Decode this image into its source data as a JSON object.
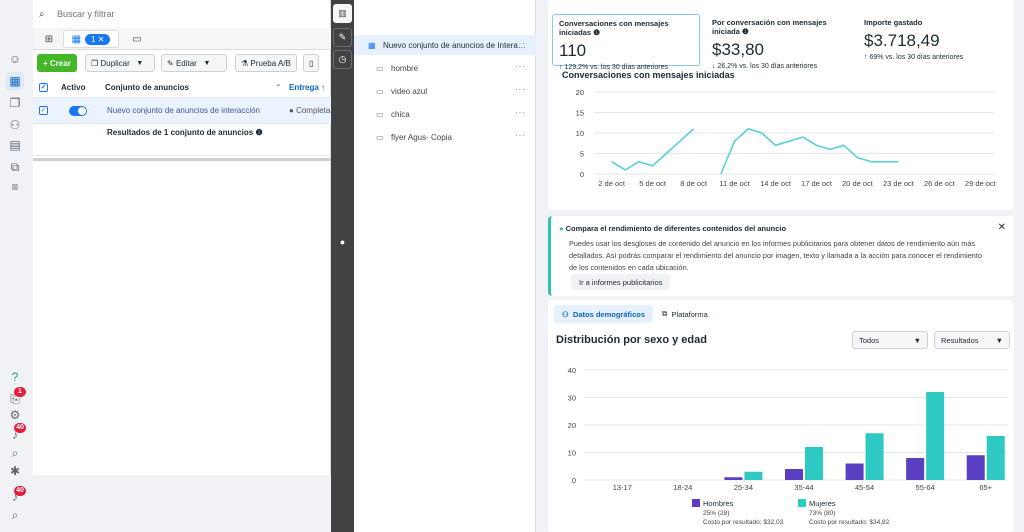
{
  "search": {
    "placeholder": "Buscar y filtrar"
  },
  "tabs": {
    "badge_count": "1"
  },
  "toolbar": {
    "create": "Crear",
    "duplicate": "Duplicar",
    "edit": "Editar",
    "ab_test": "Prueba A/B"
  },
  "table": {
    "col_active": "Activo",
    "col_adset": "Conjunto de anuncios",
    "col_delivery": "Entrega",
    "row": {
      "name": "Nuevo conjunto de anuncios de interacción",
      "delivery": "Completa"
    },
    "results": "Resultados de 1 conjunto de anuncios"
  },
  "rail": {
    "badges": [
      "1",
      "40",
      "40"
    ]
  },
  "mid_list": {
    "items": [
      {
        "label": "Nuevo conjunto de anuncios de Intera…",
        "selected": true
      },
      {
        "label": "hombre"
      },
      {
        "label": "video azul"
      },
      {
        "label": "chica"
      },
      {
        "label": "flyer Agus- Copia"
      }
    ],
    "more": "···"
  },
  "kpis": [
    {
      "label": "Conversaciones con mensajes iniciadas",
      "value": "110",
      "delta": "129,2% vs. los 30 días anteriores",
      "direction": "up"
    },
    {
      "label": "Por conversación con mensajes iniciada",
      "value": "$33,80",
      "delta": "26,2% vs. los 30 días anteriores",
      "direction": "down"
    },
    {
      "label": "Importe gastado",
      "value": "$3.718,49",
      "delta": "69% vs. los 30 días anteriores",
      "direction": "up"
    }
  ],
  "info": {
    "title": "Compara el rendimiento de diferentes contenidos del anuncio",
    "body": "Puedes usar los desgloses de contenido del anuncio en los informes publicitarios para obtener datos de rendimiento aún más detallados. Así podrás comparar el rendimiento del anuncio por imagen, texto y llamada a la acción para conocer el rendimiento de los contenidos en cada ubicación.",
    "button": "Ir a informes publicitarios"
  },
  "demographics": {
    "tab_demo": "Datos demográficos",
    "tab_platform": "Plataforma",
    "title": "Distribución por sexo y edad",
    "filter_all": "Todos",
    "filter_results": "Resultados",
    "legend": [
      {
        "name": "Hombres",
        "share": "25% (28)",
        "cost": "Costo por resultado: $32,03",
        "color": "#5b3fc2"
      },
      {
        "name": "Mujeres",
        "share": "73% (80)",
        "cost": "Costo por resultado: $34,82",
        "color": "#2fc9c4"
      }
    ]
  },
  "colors": {
    "accent": "#1877f2",
    "teal": "#2fc9c4",
    "purple": "#5b3fc2",
    "line": "#5bd0cf"
  },
  "chart_data": [
    {
      "type": "line",
      "title": "Conversaciones con mensajes iniciadas",
      "xlabel": "",
      "ylabel": "",
      "x_ticks": [
        "2 de oct",
        "5 de oct",
        "8 de oct",
        "11 de oct",
        "14 de oct",
        "17 de oct",
        "20 de oct",
        "23 de oct",
        "26 de oct",
        "29 de oct"
      ],
      "y_ticks": [
        0,
        5,
        10,
        15,
        20
      ],
      "ylim": [
        0,
        20
      ],
      "grid": true,
      "segments": [
        {
          "x": [
            1,
            2,
            3,
            4,
            5,
            6,
            7
          ],
          "y": [
            3,
            1,
            3,
            2,
            5,
            8,
            11
          ]
        },
        {
          "x": [
            9,
            10,
            11,
            12,
            13,
            14,
            15,
            16,
            17,
            18,
            19,
            20,
            21,
            22
          ],
          "y": [
            0,
            8,
            11,
            10,
            7,
            8,
            9,
            7,
            6,
            7,
            4,
            3,
            3,
            3
          ]
        }
      ]
    },
    {
      "type": "bar",
      "title": "Distribución por sexo y edad",
      "categories": [
        "13-17",
        "18-24",
        "25-34",
        "35-44",
        "45-54",
        "55-64",
        "65+"
      ],
      "y_ticks": [
        0,
        10,
        20,
        30,
        40
      ],
      "ylim": [
        0,
        40
      ],
      "grid": true,
      "series": [
        {
          "name": "Hombres",
          "values": [
            0,
            0,
            1,
            4,
            6,
            8,
            9
          ]
        },
        {
          "name": "Mujeres",
          "values": [
            0,
            0,
            3,
            12,
            17,
            32,
            16
          ]
        }
      ]
    }
  ]
}
